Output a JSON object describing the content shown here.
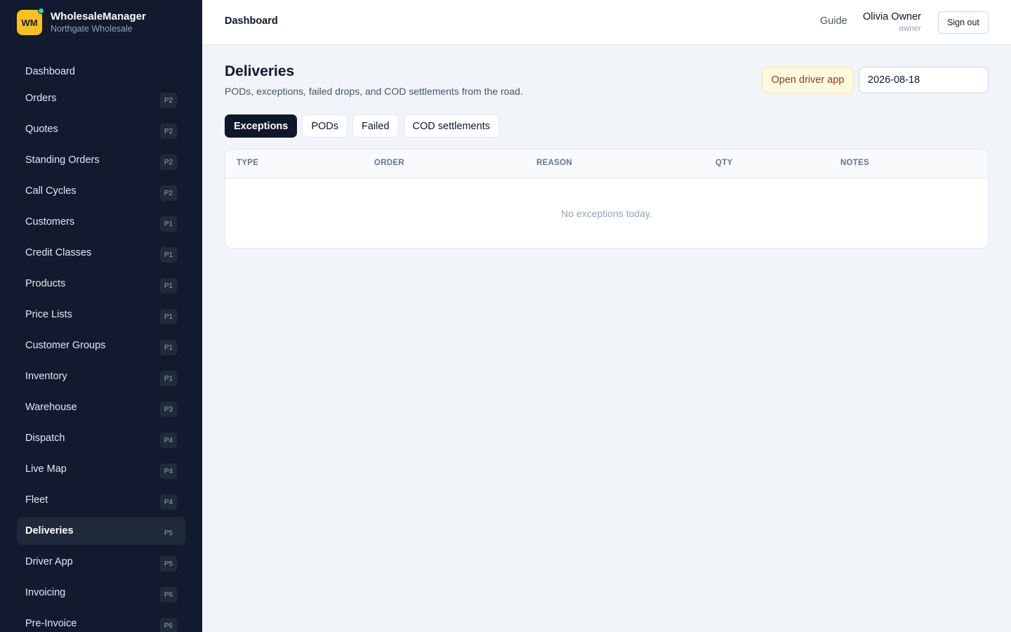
{
  "brand": {
    "logo_text": "WM",
    "name": "WholesaleManager",
    "subtitle": "Northgate Wholesale"
  },
  "sidebar": {
    "items": [
      {
        "label": "Dashboard",
        "badge": ""
      },
      {
        "label": "Orders",
        "badge": "P2"
      },
      {
        "label": "Quotes",
        "badge": "P2"
      },
      {
        "label": "Standing Orders",
        "badge": "P2"
      },
      {
        "label": "Call Cycles",
        "badge": "P2"
      },
      {
        "label": "Customers",
        "badge": "P1"
      },
      {
        "label": "Credit Classes",
        "badge": "P1"
      },
      {
        "label": "Products",
        "badge": "P1"
      },
      {
        "label": "Price Lists",
        "badge": "P1"
      },
      {
        "label": "Customer Groups",
        "badge": "P1"
      },
      {
        "label": "Inventory",
        "badge": "P1"
      },
      {
        "label": "Warehouse",
        "badge": "P3"
      },
      {
        "label": "Dispatch",
        "badge": "P4"
      },
      {
        "label": "Live Map",
        "badge": "P4"
      },
      {
        "label": "Fleet",
        "badge": "P4"
      },
      {
        "label": "Deliveries",
        "badge": "P5"
      },
      {
        "label": "Driver App",
        "badge": "P5"
      },
      {
        "label": "Invoicing",
        "badge": "P6"
      },
      {
        "label": "Pre-Invoice",
        "badge": "P6"
      }
    ],
    "active": "Deliveries"
  },
  "topbar": {
    "title": "Dashboard",
    "guide_label": "Guide",
    "user_name": "Olivia Owner",
    "user_role": "owner",
    "signout_label": "Sign out"
  },
  "page": {
    "title": "Deliveries",
    "subtitle": "PODs, exceptions, failed drops, and COD settlements from the road.",
    "driver_app_label": "Open driver app",
    "date_value": "2026-08-18"
  },
  "tabs": [
    {
      "label": "Exceptions",
      "active": true
    },
    {
      "label": "PODs",
      "active": false
    },
    {
      "label": "Failed",
      "active": false
    },
    {
      "label": "COD settlements",
      "active": false
    }
  ],
  "table": {
    "columns": [
      "TYPE",
      "ORDER",
      "REASON",
      "QTY",
      "NOTES"
    ],
    "rows": [],
    "empty_message": "No exceptions today."
  },
  "colors": {
    "sidebar_bg": "#111a2e",
    "accent": "#fbbf24",
    "status_dot": "#2dd4bf",
    "active_tab": "#0f172a"
  }
}
